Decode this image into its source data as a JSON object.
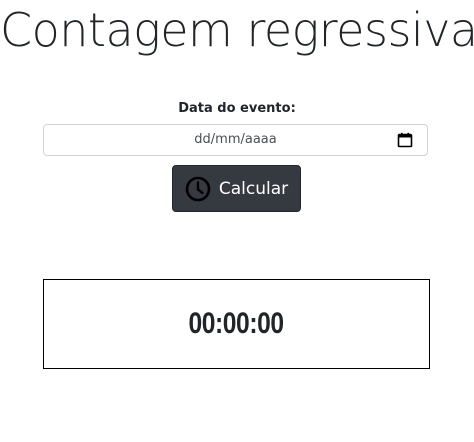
{
  "page": {
    "title": "Contagem regressiva"
  },
  "form": {
    "date_label": "Data do evento:",
    "date_placeholder": "dd/mm/aaaa",
    "calendar_icon": "calendar-icon",
    "button_label": "Calcular",
    "button_icon": "clock-icon",
    "button_color": "#343a40"
  },
  "timer": {
    "value": "00:00:00"
  }
}
